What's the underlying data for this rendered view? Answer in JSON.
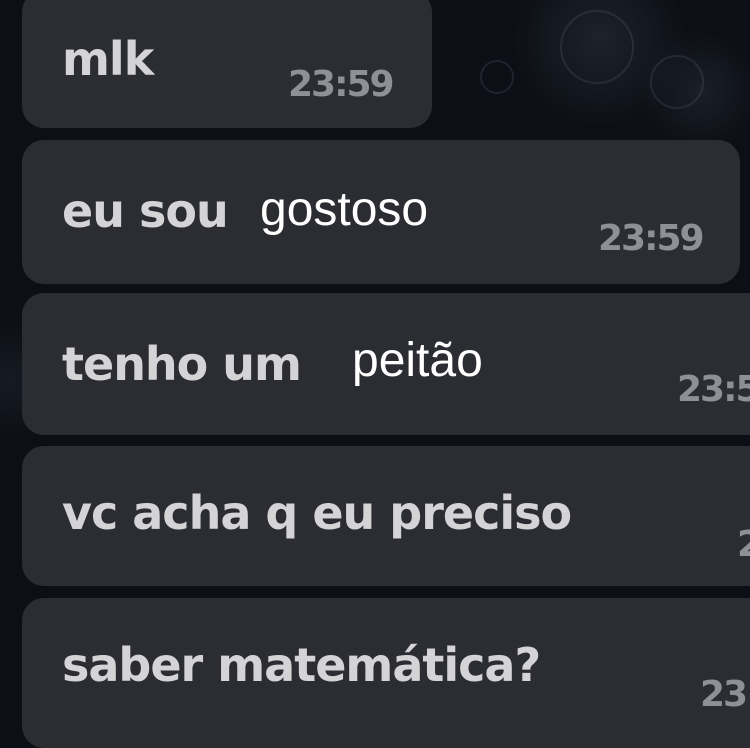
{
  "messages": [
    {
      "text": "mlk",
      "time": "23:59"
    },
    {
      "text": "eu sou",
      "overlay": "gostoso",
      "time": "23:59"
    },
    {
      "text": "tenho um",
      "overlay": "peitão",
      "time": "23:5"
    },
    {
      "text": "vc acha q eu preciso",
      "time": "2"
    },
    {
      "text": "saber matemática?",
      "time": "23"
    }
  ],
  "colors": {
    "background": "#0c0f15",
    "bubble": "#2b2d33",
    "message_text": "#d4d4d6",
    "overlay_text": "#ffffff",
    "timestamp": "#8e9096"
  }
}
